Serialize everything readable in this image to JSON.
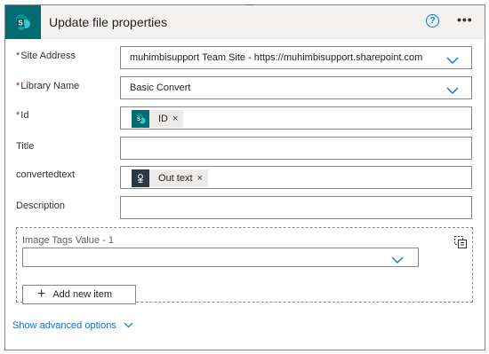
{
  "action": {
    "title": "Update file properties",
    "help_icon": "?",
    "more_icon": "•••",
    "connector_icon": "sharepoint-icon"
  },
  "fields": {
    "site_address": {
      "label": "Site Address",
      "required": "*",
      "value": "muhimbisupport Team Site - https://muhimbisupport.sharepoint.com"
    },
    "library_name": {
      "label": "Library Name",
      "required": "*",
      "value": "Basic Convert"
    },
    "id": {
      "label": "Id",
      "required": "*",
      "token": {
        "label": "ID",
        "remove": "×",
        "icon": "sharepoint-icon"
      }
    },
    "title": {
      "label": "Title",
      "value": ""
    },
    "convertedtext": {
      "label": "convertedtext",
      "token": {
        "label": "Out text",
        "remove": "×",
        "icon": "muhimbi-icon"
      }
    },
    "description": {
      "label": "Description",
      "value": ""
    }
  },
  "image_tags": {
    "label": "Image Tags Value - 1",
    "value": "",
    "add_item_label": "Add new item"
  },
  "advanced_options_label": "Show advanced options",
  "colors": {
    "sharepoint": "#036c70",
    "accent": "#0078d4",
    "required": "#a4262c",
    "muhimbi": "#2b3a42"
  }
}
